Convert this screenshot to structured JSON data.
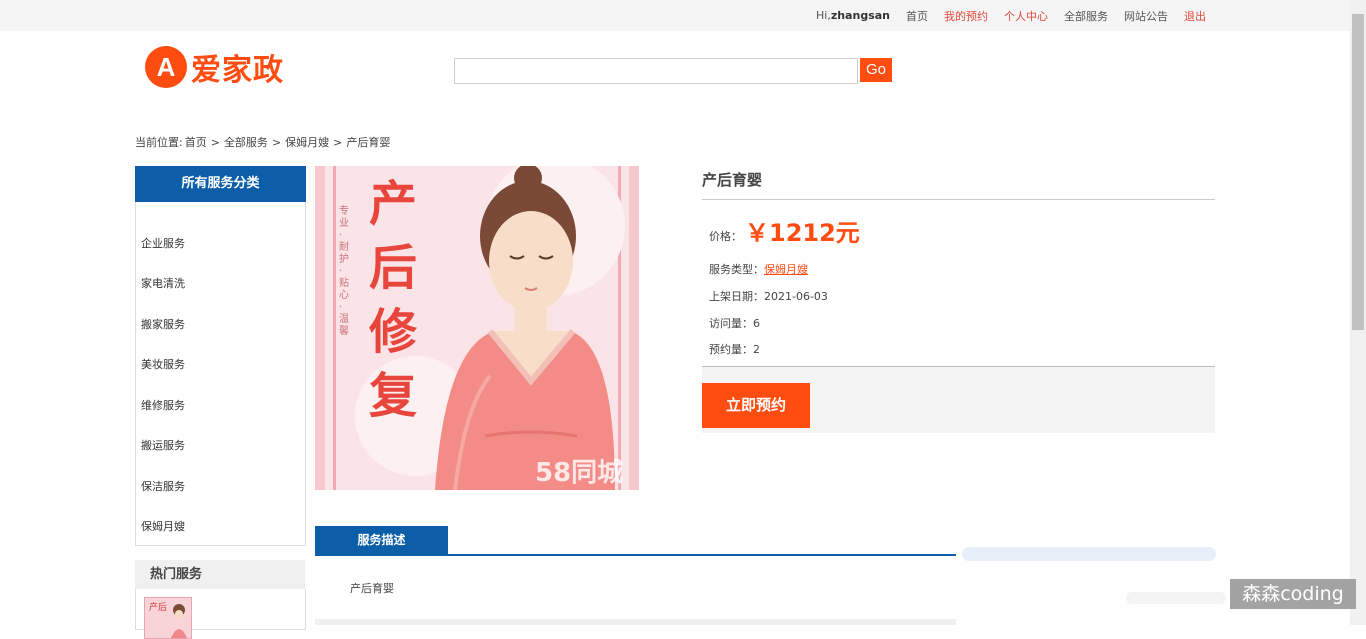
{
  "topbar": {
    "greeting_prefix": "Hi,",
    "username": "zhangsan",
    "links": [
      {
        "label": "首页",
        "color": "#555555"
      },
      {
        "label": "我的预约",
        "color": "#e0483a"
      },
      {
        "label": "个人中心",
        "color": "#e0483a"
      },
      {
        "label": "全部服务",
        "color": "#555555"
      },
      {
        "label": "网站公告",
        "color": "#555555"
      },
      {
        "label": "退出",
        "color": "#e0483a"
      }
    ]
  },
  "logo": {
    "mark": "A",
    "text": "爱家政",
    "color": "#ff4d12"
  },
  "search": {
    "value": "",
    "placeholder": "",
    "button_label": "Go"
  },
  "breadcrumb": {
    "prefix": "当前位置:",
    "items": [
      "首页",
      "全部服务",
      "保姆月嫂",
      "产后育婴"
    ],
    "separator": ">"
  },
  "sidebar": {
    "title": "所有服务分类",
    "items": [
      "企业服务",
      "家电清洗",
      "搬家服务",
      "美妆服务",
      "维修服务",
      "搬运服务",
      "保洁服务",
      "保姆月嫂"
    ],
    "hot_title": "热门服务"
  },
  "product": {
    "image_text": "产后修复",
    "image_watermark": "58同城",
    "image_tagline": "专业 · 耐护 · 贴心 · 温馨",
    "title": "产后育婴",
    "price_label": "价格：",
    "price": "￥1212元",
    "type_label": "服务类型：",
    "type_value": "保姆月嫂",
    "date_label": "上架日期：",
    "date_value": "2021-06-03",
    "visits_label": "访问量：",
    "visits_value": "6",
    "bookings_label": "预约量：",
    "bookings_value": "2",
    "book_button": "立即预约"
  },
  "tabs": {
    "active_label": "服务描述",
    "description": "产后育婴"
  },
  "watermark": "森森coding",
  "colors": {
    "brand": "#ff4d12",
    "primary_blue": "#0d5ea8"
  }
}
